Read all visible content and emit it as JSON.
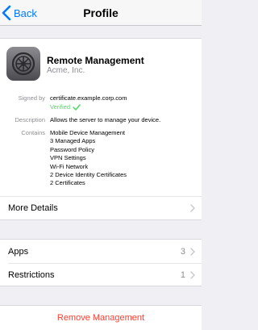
{
  "nav": {
    "back_label": "Back",
    "title": "Profile"
  },
  "profile": {
    "name": "Remote Management",
    "organization": "Acme, Inc.",
    "signed_by_label": "Signed by",
    "signed_by_value": "certificate.example.corp.com",
    "verified_label": "Verified",
    "description_label": "Description",
    "description_value": "Allows the server to manage your device.",
    "contains_label": "Contains",
    "contains": [
      "Mobile Device Management",
      "3 Managed Apps",
      "Password Policy",
      "VPN Settings",
      "Wi-Fi Network",
      "2 Device Identity Certificates",
      "2 Certificates"
    ]
  },
  "more_details": {
    "label": "More Details"
  },
  "apps": {
    "label": "Apps",
    "count": "3"
  },
  "restrictions": {
    "label": "Restrictions",
    "count": "1"
  },
  "remove": {
    "label": "Remove Management"
  },
  "colors": {
    "accent": "#007aff",
    "verified": "#4cd964",
    "destructive": "#ff3b30"
  },
  "icons": [
    "back-chevron-icon",
    "settings-gear-icon",
    "checkmark-icon",
    "chevron-right-icon"
  ]
}
